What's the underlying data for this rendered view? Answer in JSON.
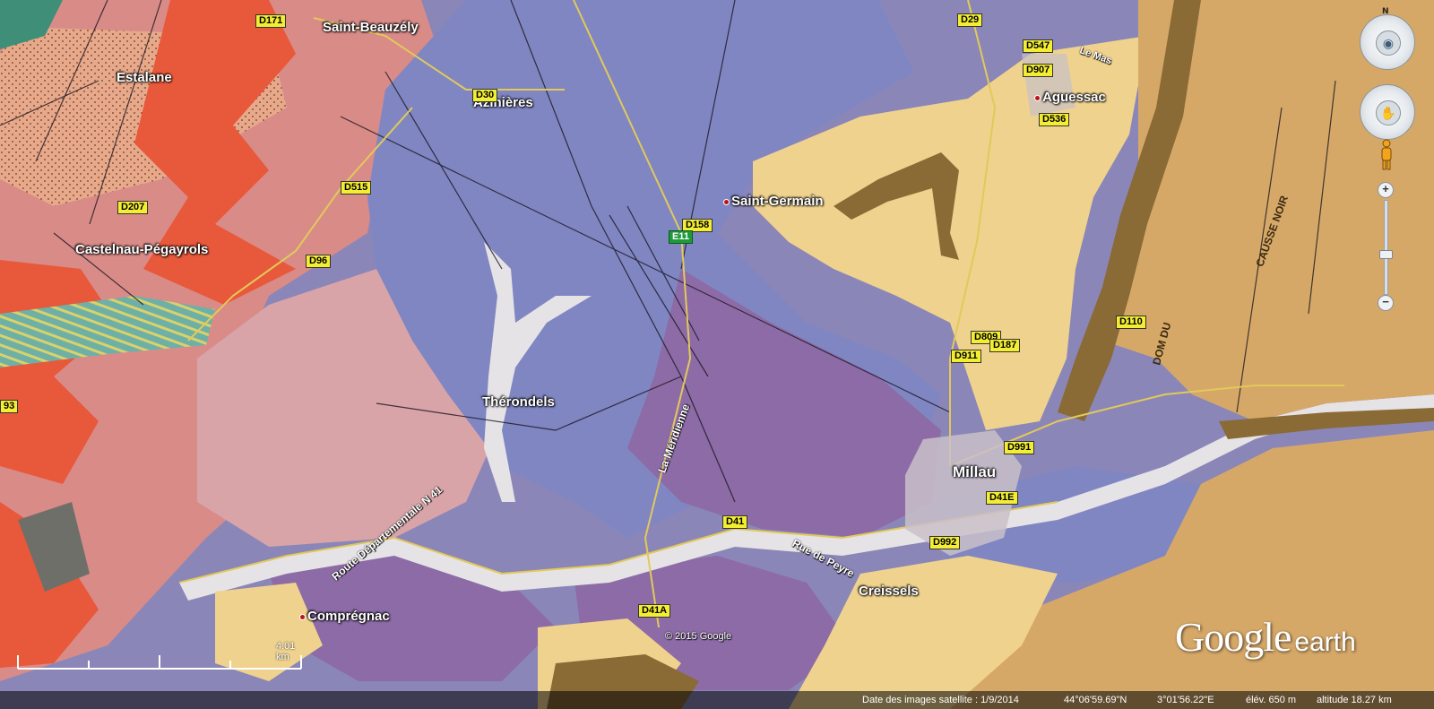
{
  "places": [
    {
      "name": "Saint-Beauzély",
      "marker": false
    },
    {
      "name": "Estalane",
      "marker": false
    },
    {
      "name": "Azinières",
      "marker": false
    },
    {
      "name": "Aguessac",
      "marker": true
    },
    {
      "name": "Saint-Germain",
      "marker": true
    },
    {
      "name": "Castelnau-Pégayrols",
      "marker": false
    },
    {
      "name": "Thérondels",
      "marker": false
    },
    {
      "name": "Millau",
      "marker": false
    },
    {
      "name": "Creissels",
      "marker": false
    },
    {
      "name": "Comprégnac",
      "marker": true
    }
  ],
  "road_shields": [
    {
      "label": "D171",
      "style": "yellow"
    },
    {
      "label": "D30",
      "style": "yellow"
    },
    {
      "label": "D29",
      "style": "yellow"
    },
    {
      "label": "D547",
      "style": "yellow"
    },
    {
      "label": "D907",
      "style": "yellow"
    },
    {
      "label": "D536",
      "style": "yellow"
    },
    {
      "label": "D515",
      "style": "yellow"
    },
    {
      "label": "D207",
      "style": "yellow"
    },
    {
      "label": "D96",
      "style": "yellow"
    },
    {
      "label": "D158",
      "style": "yellow"
    },
    {
      "label": "E11",
      "style": "green"
    },
    {
      "label": "D809",
      "style": "yellow"
    },
    {
      "label": "D187",
      "style": "yellow"
    },
    {
      "label": "D911",
      "style": "yellow"
    },
    {
      "label": "D110",
      "style": "yellow"
    },
    {
      "label": "D991",
      "style": "yellow"
    },
    {
      "label": "D41E",
      "style": "yellow"
    },
    {
      "label": "D41",
      "style": "yellow"
    },
    {
      "label": "D41A",
      "style": "yellow"
    },
    {
      "label": "D992",
      "style": "yellow"
    },
    {
      "label": "93",
      "style": "yellow"
    }
  ],
  "street_labels": [
    {
      "text": "Route Départementale N 41"
    },
    {
      "text": "Rue de Peyre"
    },
    {
      "text": "La Méridienne"
    }
  ],
  "map_texts": [
    "Le Mas",
    "CAUSSE NOIR",
    "DOM DU"
  ],
  "map_colors": {
    "limestone_blue": "#7f86c2",
    "marl_purple": "#8d6ba6",
    "sandstone_pink": "#d98b88",
    "red_unit": "#e8583a",
    "causse_yellow": "#efd28d",
    "causse_tan": "#d6a868",
    "cliff_brown": "#8a6a35",
    "alluvium_white": "#e6e3e6"
  },
  "navigation": {
    "north_label": "N",
    "zoom_in": "+",
    "zoom_out": "−",
    "zoom_level_fraction": 0.58
  },
  "copyright": "© 2015 Google",
  "brand": {
    "google": "Google",
    "earth": "earth"
  },
  "scale": {
    "label": "4.01 km"
  },
  "status_bar": {
    "imagery_date": "Date des images satellite : 1/9/2014",
    "latitude": "44°06'59.69\"N",
    "longitude": "3°01'56.22\"E",
    "elevation": "élév.  650 m",
    "eye_altitude": "altitude  18.27 km"
  }
}
